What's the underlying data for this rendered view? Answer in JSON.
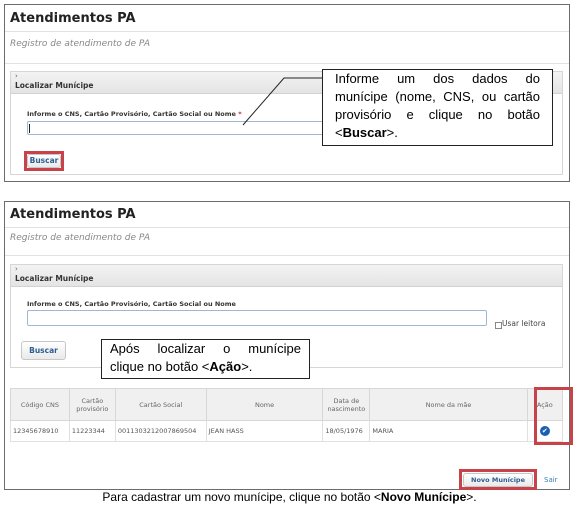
{
  "panel1": {
    "title": "Atendimentos PA",
    "subtitle": "Registro de atendimento de PA",
    "section_chevron": "›",
    "section_title": "Localizar Munícipe",
    "field_label": "Informe o CNS, Cartão Provisório, Cartão Social ou Nome",
    "required_mark": "*",
    "search_button": "Buscar",
    "callout": {
      "line1": "Informe um dos dados do",
      "line2": "munícipe (nome, CNS, ou cartão",
      "line3": "provisório e clique no botão",
      "line4_pre": "<",
      "line4_bold": "Buscar",
      "line4_post": ">."
    }
  },
  "panel2": {
    "title": "Atendimentos PA",
    "subtitle": "Registro de atendimento de PA",
    "section_chevron": "›",
    "section_title": "Localizar Munícipe",
    "field_label": "Informe o CNS, Cartão Provisório, Cartão Social ou Nome",
    "reader_label": "Usar leitora",
    "search_button": "Buscar",
    "callout": {
      "line1": "Após localizar o munícipe",
      "line2_pre": "clique no botão <",
      "line2_bold": "Ação",
      "line2_post": ">."
    },
    "table": {
      "headers": [
        "Código CNS",
        "Cartão provisório",
        "Cartão Social",
        "Nome",
        "Data de nascimento",
        "Nome da mãe",
        "Ação"
      ],
      "rows": [
        [
          "12345678910",
          "11223344",
          "0011303212007869504",
          "JEAN HASS",
          "18/05/1976",
          "MARIA"
        ]
      ]
    },
    "new_button": "Novo Munícipe",
    "exit_link": "Sair"
  },
  "caption": {
    "pre": "Para cadastrar um novo munícipe, clique no botão <",
    "bold": "Novo Munícipe",
    "post": ">."
  },
  "colors": {
    "highlight": "#c8424a",
    "link": "#2c5d91",
    "action": "#1a5fb4"
  }
}
